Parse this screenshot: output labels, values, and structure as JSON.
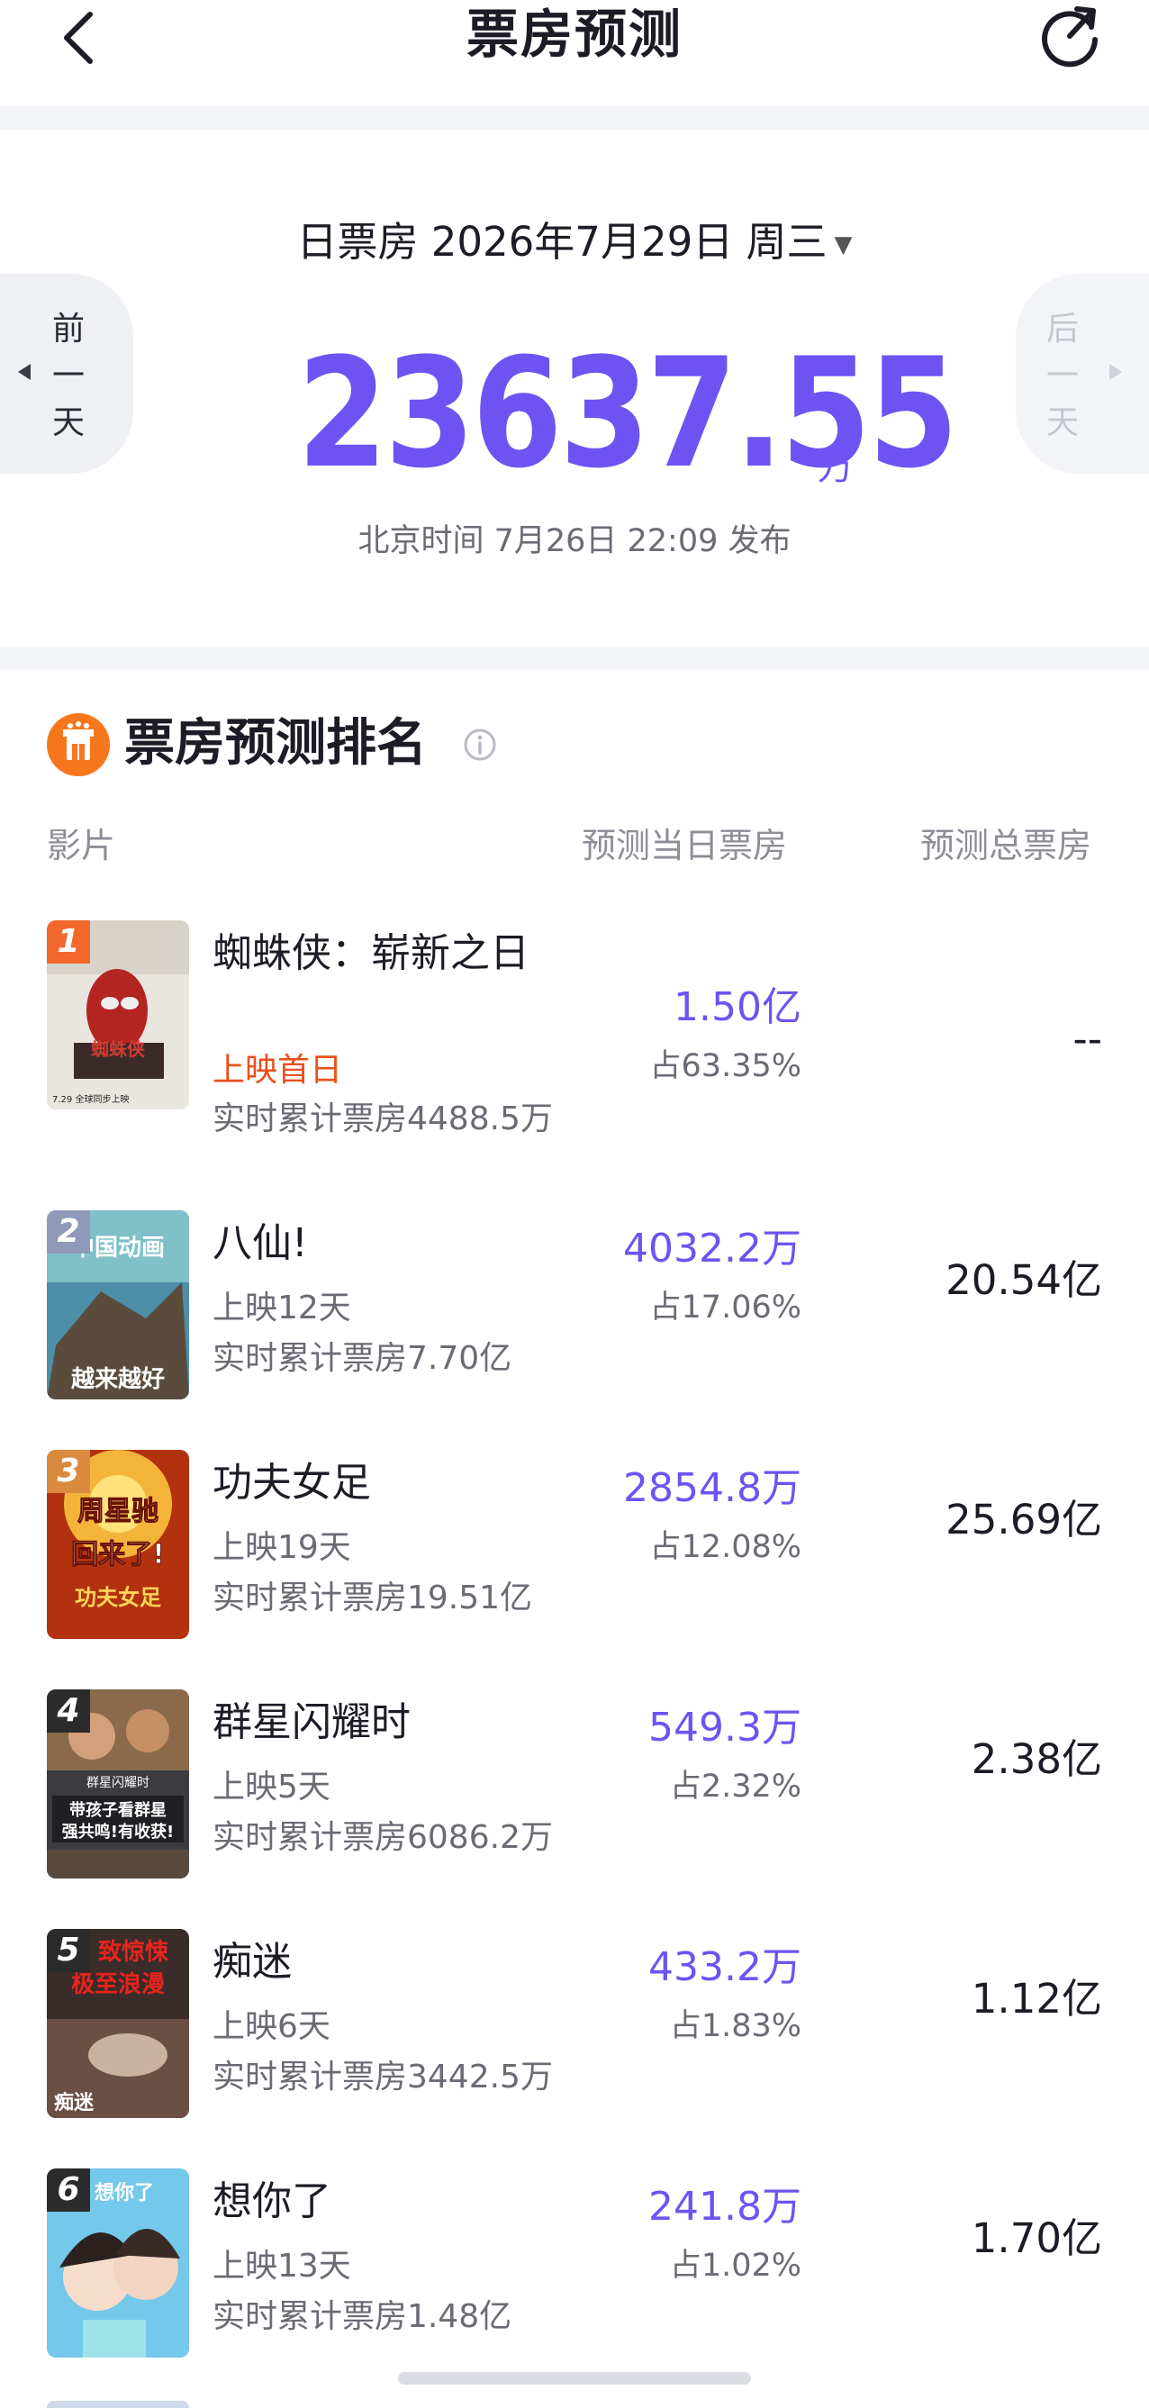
{
  "header": {
    "title": "票房预测",
    "back_icon": "chevron-left-icon",
    "refresh_icon": "refresh-icon"
  },
  "summary": {
    "date_label": "日票房 2026年7月29日 周三",
    "prev_day": [
      "前",
      "一",
      "天"
    ],
    "next_day": [
      "后",
      "一",
      "天"
    ],
    "total_value": "23637.55",
    "total_unit": "万",
    "publish_time": "北京时间 7月26日 22:09 发布",
    "accent_color": "#6e53f2"
  },
  "ranking": {
    "title": "票房预测排名",
    "columns": {
      "film": "影片",
      "daily": "预测当日票房",
      "total": "预测总票房"
    },
    "films": [
      {
        "rank": "1",
        "title": "蜘蛛侠：崭新之日",
        "status": "上映首日",
        "cumulative": "实时累计票房4488.5万",
        "daily": "1.50亿",
        "share": "占63.35%",
        "total": "--",
        "badge_color": "#f2682c",
        "poster_text": [
          "蜘蛛侠",
          "7.29 全球同步上映"
        ]
      },
      {
        "rank": "2",
        "title": "八仙!",
        "status": "上映12天",
        "cumulative": "实时累计票房7.70亿",
        "daily": "4032.2万",
        "share": "占17.06%",
        "total": "20.54亿",
        "badge_color": "#8e9ab8",
        "poster_text": [
          "中国动画",
          "越来越好"
        ]
      },
      {
        "rank": "3",
        "title": "功夫女足",
        "status": "上映19天",
        "cumulative": "实时累计票房19.51亿",
        "daily": "2854.8万",
        "share": "占12.08%",
        "total": "25.69亿",
        "badge_color": "#d98a3d",
        "poster_text": [
          "周星驰",
          "回来了!",
          "功夫女足"
        ]
      },
      {
        "rank": "4",
        "title": "群星闪耀时",
        "status": "上映5天",
        "cumulative": "实时累计票房6086.2万",
        "daily": "549.3万",
        "share": "占2.32%",
        "total": "2.38亿",
        "badge_color": "#2b2b2b",
        "poster_text": [
          "群星闪耀时",
          "带孩子看群星",
          "强共鸣!有收获!"
        ]
      },
      {
        "rank": "5",
        "title": "痴迷",
        "status": "上映6天",
        "cumulative": "实时累计票房3442.5万",
        "daily": "433.2万",
        "share": "占1.83%",
        "total": "1.12亿",
        "badge_color": "#2b2b2b",
        "poster_text": [
          "致惊悚",
          "极至浪漫",
          "痴迷"
        ]
      },
      {
        "rank": "6",
        "title": "想你了",
        "status": "上映13天",
        "cumulative": "实时累计票房1.48亿",
        "daily": "241.8万",
        "share": "占1.02%",
        "total": "1.70亿",
        "badge_color": "#2b2b2b",
        "poster_text": [
          "想你了"
        ]
      }
    ]
  }
}
